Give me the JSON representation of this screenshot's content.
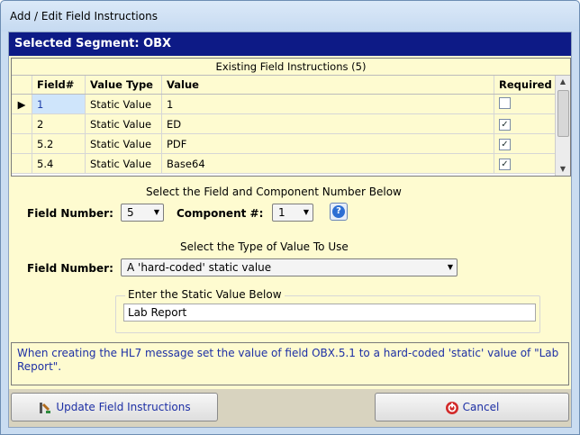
{
  "window": {
    "title": "Add / Edit Field Instructions"
  },
  "segment_header": "Selected Segment: OBX",
  "grid": {
    "caption": "Existing Field Instructions (5)",
    "columns": [
      "Field#",
      "Value Type",
      "Value",
      "Required"
    ],
    "rows": [
      {
        "field": "1",
        "type": "Static Value",
        "value": "1",
        "required": false
      },
      {
        "field": "2",
        "type": "Static Value",
        "value": "ED",
        "required": true
      },
      {
        "field": "5.2",
        "type": "Static Value",
        "value": "PDF",
        "required": true
      },
      {
        "field": "5.4",
        "type": "Static Value",
        "value": "Base64",
        "required": true
      }
    ]
  },
  "field_section": {
    "heading": "Select the Field and Component Number Below",
    "field_label": "Field Number:",
    "field_value": "5",
    "component_label": "Component #:",
    "component_value": "1"
  },
  "type_section": {
    "heading": "Select the Type of Value To Use",
    "label": "Field Number:",
    "selected": "A 'hard-coded' static value"
  },
  "static_group": {
    "title": "Enter the Static Value Below",
    "value": "Lab Report"
  },
  "info_text": "When creating the HL7 message set the value of field OBX.5.1 to a hard-coded 'static' value of \"Lab Report\".",
  "buttons": {
    "update": "Update Field Instructions",
    "cancel": "Cancel"
  },
  "colors": {
    "header": "#0d1a86",
    "panel": "#fefbd0",
    "info_text": "#1d2fa5"
  }
}
